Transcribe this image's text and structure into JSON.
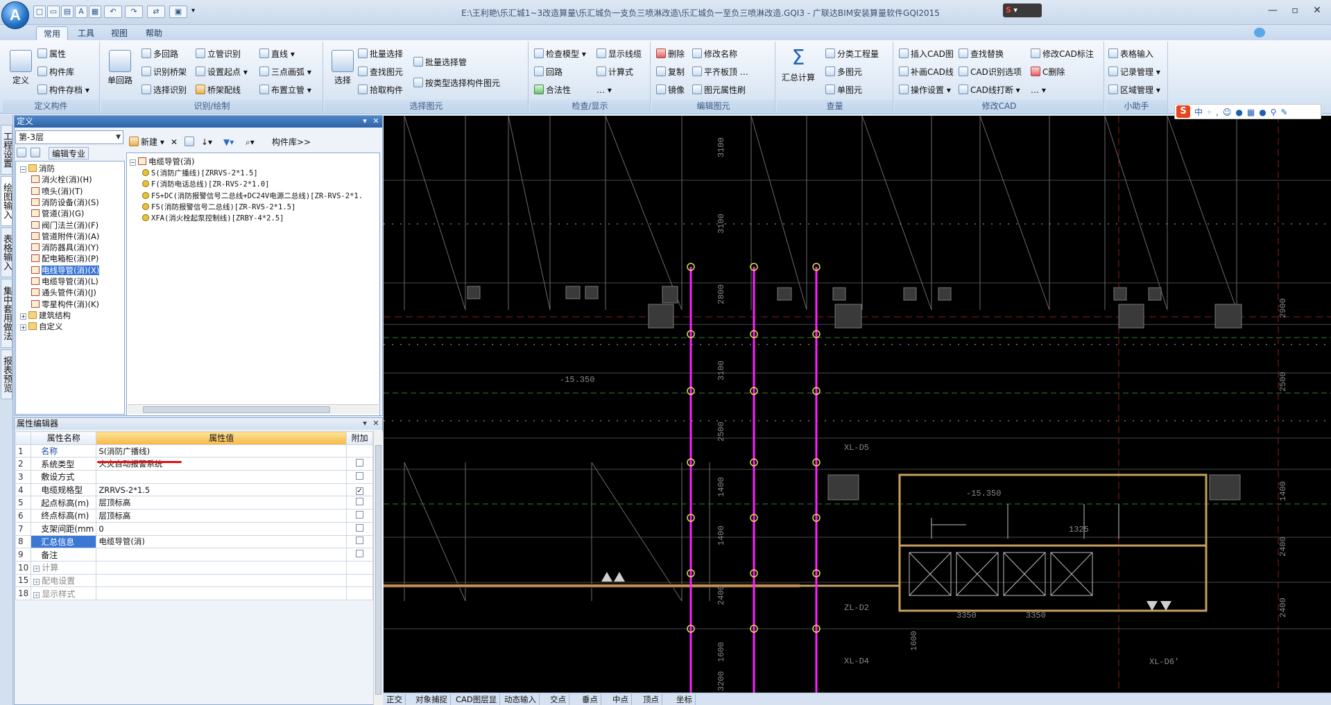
{
  "app": {
    "orb_letter": "A",
    "window_title": "E:\\王利艳\\乐汇城1~3改造算量\\乐汇城负一支负三喷淋改造\\乐汇城负一至负三喷淋改造.GQI3 - 广联达BIM安装算量软件GQI2015"
  },
  "sogou_top": "S",
  "menu_tabs": [
    "常用",
    "工具",
    "视图",
    "帮助"
  ],
  "ribbon": {
    "groups": [
      {
        "label": "定义构件",
        "big": "定义",
        "items": [
          "属性",
          "构件库",
          "构件存档"
        ]
      },
      {
        "label": "识别/绘制",
        "big": "单回路",
        "items": [
          "多回路",
          "识别桥架",
          "选择识别",
          "立管识别",
          "设置起点",
          "桥架配线",
          "直线",
          "三点画弧",
          "布置立管"
        ]
      },
      {
        "label": "选择图元",
        "big": "选择",
        "items": [
          "批量选择",
          "查找图元",
          "拾取构件",
          "批量选择管",
          "按类型选择构件图元"
        ]
      },
      {
        "label": "检查/显示",
        "items": [
          "检查模型",
          "回路",
          "合法性",
          "显示线缆",
          "计算式"
        ]
      },
      {
        "label": "编辑图元",
        "items": [
          "删除",
          "复制",
          "镜像",
          "修改名称",
          "平齐板顶",
          "图元属性刷"
        ]
      },
      {
        "label": "查量",
        "big": "汇总计算",
        "items": [
          "分类工程量",
          "多图元",
          "单图元"
        ]
      },
      {
        "label": "修改CAD",
        "items": [
          "插入CAD图",
          "补画CAD线",
          "操作设置",
          "查找替换",
          "CAD识别选项",
          "CAD线打断",
          "修改CAD标注",
          "C删除"
        ]
      },
      {
        "label": "小助手",
        "items": [
          "表格输入",
          "记录管理",
          "区域管理"
        ]
      }
    ]
  },
  "left_tabs": [
    "工程设置",
    "绘图输入",
    "表格输入",
    "集中套用做法",
    "报表预览"
  ],
  "define_panel": {
    "title": "定义",
    "floor": "第-3层",
    "toolbar": [
      "编辑专业",
      "新建",
      "构件库>>"
    ],
    "tree": [
      {
        "label": "消防",
        "level": 0
      },
      {
        "label": "消火栓(消)(H)",
        "level": 1
      },
      {
        "label": "喷头(消)(T)",
        "level": 1
      },
      {
        "label": "消防设备(消)(S)",
        "level": 1
      },
      {
        "label": "管道(消)(G)",
        "level": 1
      },
      {
        "label": "阀门法兰(消)(F)",
        "level": 1
      },
      {
        "label": "管道附件(消)(A)",
        "level": 1
      },
      {
        "label": "消防器具(消)(Y)",
        "level": 1
      },
      {
        "label": "配电箱柜(消)(P)",
        "level": 1
      },
      {
        "label": "电线导管(消)(X)",
        "level": 1
      },
      {
        "label": "电缆导管(消)(L)",
        "level": 1
      },
      {
        "label": "通头管件(消)(J)",
        "level": 1
      },
      {
        "label": "零星构件(消)(K)",
        "level": 1
      },
      {
        "label": "建筑结构",
        "level": 0
      },
      {
        "label": "自定义",
        "level": 0
      }
    ],
    "components_root": "电缆导管(消)",
    "components": [
      "S(消防广播线)[ZRRVS-2*1.5]",
      "F(消防电话总线)[ZR-RVS-2*1.0]",
      "FS+DC(消防报警信号二总线+DC24V电源二总线)[ZR-RVS-2*1.",
      "FS(消防报警信号二总线)[ZR-RVS-2*1.5]",
      "XFA(消火栓起泵控制线)[ZRBY-4*2.5]"
    ]
  },
  "prop_panel": {
    "title": "属性编辑器",
    "headers": [
      "属性名称",
      "属性值",
      "附加"
    ],
    "rows": [
      {
        "n": "1",
        "name": "名称",
        "value": "S(消防广播线)",
        "check": ""
      },
      {
        "n": "2",
        "name": "系统类型",
        "value": "火灾自动报警系统",
        "check": "box"
      },
      {
        "n": "3",
        "name": "敷设方式",
        "value": "",
        "check": "box"
      },
      {
        "n": "4",
        "name": "电缆规格型",
        "value": "ZRRVS-2*1.5",
        "check": "checked"
      },
      {
        "n": "5",
        "name": "起点标高(m)",
        "value": "层顶标高",
        "check": "box"
      },
      {
        "n": "6",
        "name": "终点标高(m)",
        "value": "层顶标高",
        "check": "box"
      },
      {
        "n": "7",
        "name": "支架间距(mm",
        "value": "0",
        "check": "box"
      },
      {
        "n": "8",
        "name": "汇总信息",
        "value": "电缆导管(消)",
        "check": "box"
      },
      {
        "n": "9",
        "name": "备注",
        "value": "",
        "check": "box"
      },
      {
        "n": "10",
        "name": "计算",
        "value": "",
        "check": ""
      },
      {
        "n": "15",
        "name": "配电设置",
        "value": "",
        "check": ""
      },
      {
        "n": "18",
        "name": "显示样式",
        "value": "",
        "check": ""
      }
    ]
  },
  "canvas": {
    "labels": [
      "3100",
      "3100",
      "2800",
      "3100",
      "2500",
      "1400",
      "1400",
      "2400",
      "1600",
      "3200",
      "2900",
      "2500",
      "1400",
      "2400",
      "2400",
      "-15.350",
      "-15.350",
      "XL-D5",
      "ZL-D2",
      "XL-D4",
      "XL-D6'",
      "3350",
      "3350",
      "1325",
      "1600"
    ]
  },
  "status_bar": [
    "正交",
    "对象捕捉",
    "CAD图层显",
    "动态输入",
    "交点",
    "垂点",
    "中点",
    "顶点",
    "坐标"
  ],
  "colors": {
    "canvas_bg": "#000000",
    "cable": "#ff20ff",
    "title_bar": "#3c74b8"
  }
}
